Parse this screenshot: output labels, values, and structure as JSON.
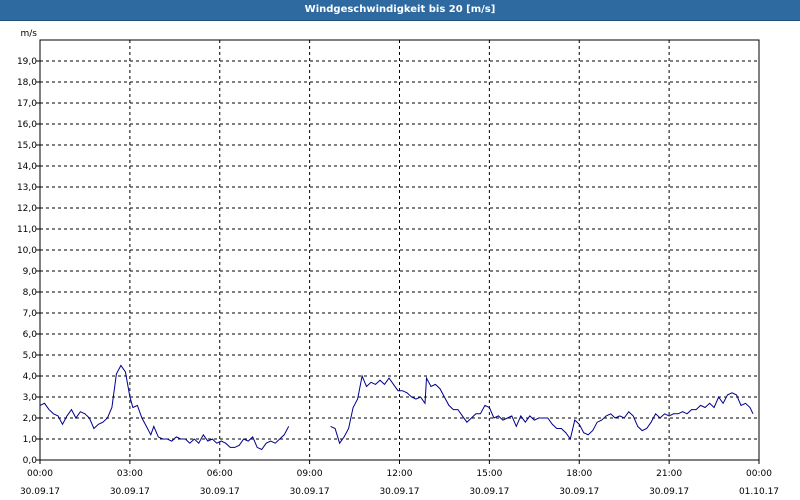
{
  "window": {
    "title": "Windgeschwindigkeit bis 20 [m/s]"
  },
  "chart_data": {
    "type": "line",
    "title": "Windgeschwindigkeit bis 20 [m/s]",
    "ylabel": "m/s",
    "xlabel": "",
    "ylim": [
      0,
      20
    ],
    "xlim_hours": [
      0,
      24
    ],
    "grid": true,
    "y_ticks": [
      "0,0",
      "1,0",
      "2,0",
      "3,0",
      "4,0",
      "5,0",
      "6,0",
      "7,0",
      "8,0",
      "9,0",
      "10,0",
      "11,0",
      "12,0",
      "13,0",
      "14,0",
      "15,0",
      "16,0",
      "17,0",
      "18,0",
      "19,0"
    ],
    "x_ticks": [
      {
        "time": "00:00",
        "date": "30.09.17"
      },
      {
        "time": "03:00",
        "date": "30.09.17"
      },
      {
        "time": "06:00",
        "date": "30.09.17"
      },
      {
        "time": "09:00",
        "date": "30.09.17"
      },
      {
        "time": "12:00",
        "date": "30.09.17"
      },
      {
        "time": "15:00",
        "date": "30.09.17"
      },
      {
        "time": "18:00",
        "date": "30.09.17"
      },
      {
        "time": "21:00",
        "date": "30.09.17"
      },
      {
        "time": "00:00",
        "date": "01.10.17"
      }
    ],
    "series": [
      {
        "color": "#00008b",
        "segments": [
          [
            [
              0.0,
              2.6
            ],
            [
              0.15,
              2.7
            ],
            [
              0.3,
              2.4
            ],
            [
              0.45,
              2.2
            ],
            [
              0.6,
              2.1
            ],
            [
              0.75,
              1.7
            ],
            [
              0.9,
              2.1
            ],
            [
              1.05,
              2.4
            ],
            [
              1.2,
              2.0
            ],
            [
              1.35,
              2.3
            ],
            [
              1.5,
              2.2
            ],
            [
              1.65,
              2.0
            ],
            [
              1.8,
              1.5
            ],
            [
              1.95,
              1.7
            ],
            [
              2.1,
              1.8
            ],
            [
              2.25,
              2.0
            ],
            [
              2.4,
              2.5
            ],
            [
              2.55,
              4.1
            ],
            [
              2.7,
              4.5
            ],
            [
              2.85,
              4.2
            ],
            [
              3.0,
              3.0
            ],
            [
              3.1,
              2.5
            ],
            [
              3.25,
              2.6
            ],
            [
              3.4,
              2.0
            ],
            [
              3.55,
              1.6
            ],
            [
              3.7,
              1.2
            ],
            [
              3.8,
              1.6
            ],
            [
              3.95,
              1.1
            ],
            [
              4.1,
              1.0
            ],
            [
              4.25,
              1.0
            ],
            [
              4.4,
              0.9
            ],
            [
              4.55,
              1.1
            ],
            [
              4.7,
              1.0
            ],
            [
              4.85,
              1.0
            ],
            [
              5.0,
              0.8
            ],
            [
              5.15,
              1.0
            ],
            [
              5.3,
              0.8
            ],
            [
              5.45,
              1.2
            ],
            [
              5.6,
              0.9
            ],
            [
              5.75,
              1.0
            ],
            [
              5.9,
              0.8
            ],
            [
              6.05,
              0.9
            ],
            [
              6.2,
              0.8
            ],
            [
              6.35,
              0.6
            ],
            [
              6.5,
              0.6
            ],
            [
              6.65,
              0.7
            ],
            [
              6.8,
              1.0
            ],
            [
              6.95,
              0.9
            ],
            [
              7.1,
              1.1
            ],
            [
              7.25,
              0.6
            ],
            [
              7.4,
              0.5
            ],
            [
              7.55,
              0.8
            ],
            [
              7.7,
              0.9
            ],
            [
              7.85,
              0.8
            ],
            [
              8.0,
              1.0
            ],
            [
              8.15,
              1.2
            ],
            [
              8.3,
              1.6
            ]
          ],
          [
            [
              9.7,
              1.6
            ],
            [
              9.85,
              1.5
            ],
            [
              10.0,
              0.8
            ],
            [
              10.15,
              1.1
            ],
            [
              10.3,
              1.5
            ],
            [
              10.45,
              2.5
            ],
            [
              10.6,
              2.9
            ],
            [
              10.75,
              4.0
            ],
            [
              10.9,
              3.5
            ],
            [
              11.05,
              3.7
            ],
            [
              11.2,
              3.6
            ],
            [
              11.35,
              3.8
            ],
            [
              11.5,
              3.6
            ],
            [
              11.65,
              3.9
            ],
            [
              11.8,
              3.6
            ],
            [
              11.95,
              3.3
            ],
            [
              12.1,
              3.3
            ],
            [
              12.25,
              3.2
            ],
            [
              12.4,
              3.0
            ],
            [
              12.55,
              2.9
            ],
            [
              12.7,
              3.0
            ],
            [
              12.85,
              2.7
            ],
            [
              12.9,
              3.9
            ],
            [
              13.05,
              3.5
            ],
            [
              13.2,
              3.6
            ],
            [
              13.35,
              3.4
            ],
            [
              13.5,
              3.0
            ],
            [
              13.65,
              2.6
            ],
            [
              13.8,
              2.4
            ],
            [
              13.95,
              2.4
            ],
            [
              14.1,
              2.1
            ],
            [
              14.25,
              1.8
            ],
            [
              14.4,
              2.0
            ],
            [
              14.55,
              2.2
            ],
            [
              14.7,
              2.2
            ],
            [
              14.85,
              2.6
            ],
            [
              15.0,
              2.5
            ],
            [
              15.15,
              2.0
            ],
            [
              15.3,
              2.1
            ],
            [
              15.45,
              1.9
            ],
            [
              15.6,
              2.0
            ],
            [
              15.75,
              2.1
            ],
            [
              15.9,
              1.6
            ],
            [
              16.05,
              2.1
            ],
            [
              16.2,
              1.8
            ],
            [
              16.35,
              2.1
            ],
            [
              16.5,
              1.9
            ],
            [
              16.65,
              2.0
            ],
            [
              16.8,
              2.0
            ],
            [
              16.95,
              2.0
            ],
            [
              17.1,
              1.7
            ],
            [
              17.25,
              1.5
            ],
            [
              17.4,
              1.5
            ],
            [
              17.55,
              1.3
            ],
            [
              17.7,
              1.0
            ],
            [
              17.85,
              1.9
            ],
            [
              18.0,
              1.7
            ],
            [
              18.15,
              1.3
            ],
            [
              18.3,
              1.2
            ],
            [
              18.45,
              1.4
            ],
            [
              18.6,
              1.8
            ],
            [
              18.75,
              1.9
            ],
            [
              18.9,
              2.1
            ],
            [
              19.05,
              2.2
            ],
            [
              19.2,
              2.0
            ],
            [
              19.35,
              2.1
            ],
            [
              19.5,
              2.0
            ],
            [
              19.65,
              2.3
            ],
            [
              19.8,
              2.1
            ],
            [
              19.95,
              1.6
            ],
            [
              20.1,
              1.4
            ],
            [
              20.25,
              1.5
            ],
            [
              20.4,
              1.8
            ],
            [
              20.55,
              2.2
            ],
            [
              20.7,
              2.0
            ],
            [
              20.85,
              2.2
            ],
            [
              21.0,
              2.1
            ],
            [
              21.15,
              2.2
            ],
            [
              21.3,
              2.2
            ],
            [
              21.45,
              2.3
            ],
            [
              21.6,
              2.2
            ],
            [
              21.75,
              2.4
            ],
            [
              21.9,
              2.4
            ],
            [
              22.05,
              2.6
            ],
            [
              22.2,
              2.5
            ],
            [
              22.35,
              2.7
            ],
            [
              22.5,
              2.5
            ],
            [
              22.65,
              3.0
            ],
            [
              22.8,
              2.7
            ],
            [
              22.95,
              3.1
            ],
            [
              23.1,
              3.2
            ],
            [
              23.25,
              3.1
            ],
            [
              23.4,
              2.6
            ],
            [
              23.55,
              2.7
            ],
            [
              23.7,
              2.5
            ],
            [
              23.8,
              2.2
            ]
          ]
        ]
      }
    ]
  }
}
